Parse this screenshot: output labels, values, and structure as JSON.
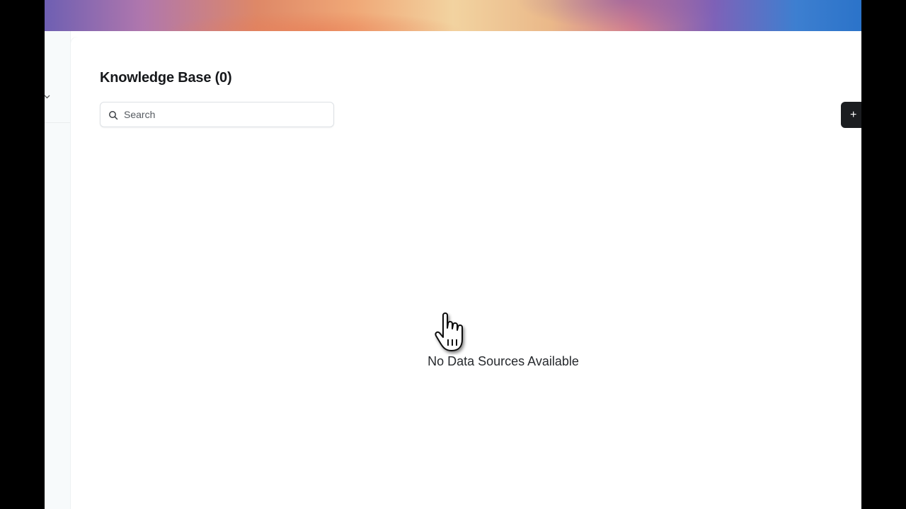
{
  "page": {
    "title": "Knowledge Base (0)"
  },
  "search": {
    "placeholder": "Search",
    "value": ""
  },
  "toolbar": {
    "add_label": "+"
  },
  "empty_state": {
    "message": "No Data Sources Available"
  },
  "icons": {
    "search": "search-icon",
    "chevron": "chevron-down-icon",
    "cursor": "hand-pointer-cursor"
  },
  "colors": {
    "primary_button": "#1b1d20",
    "title_text": "#16181b",
    "sidebar_bg": "#f7fafb"
  }
}
